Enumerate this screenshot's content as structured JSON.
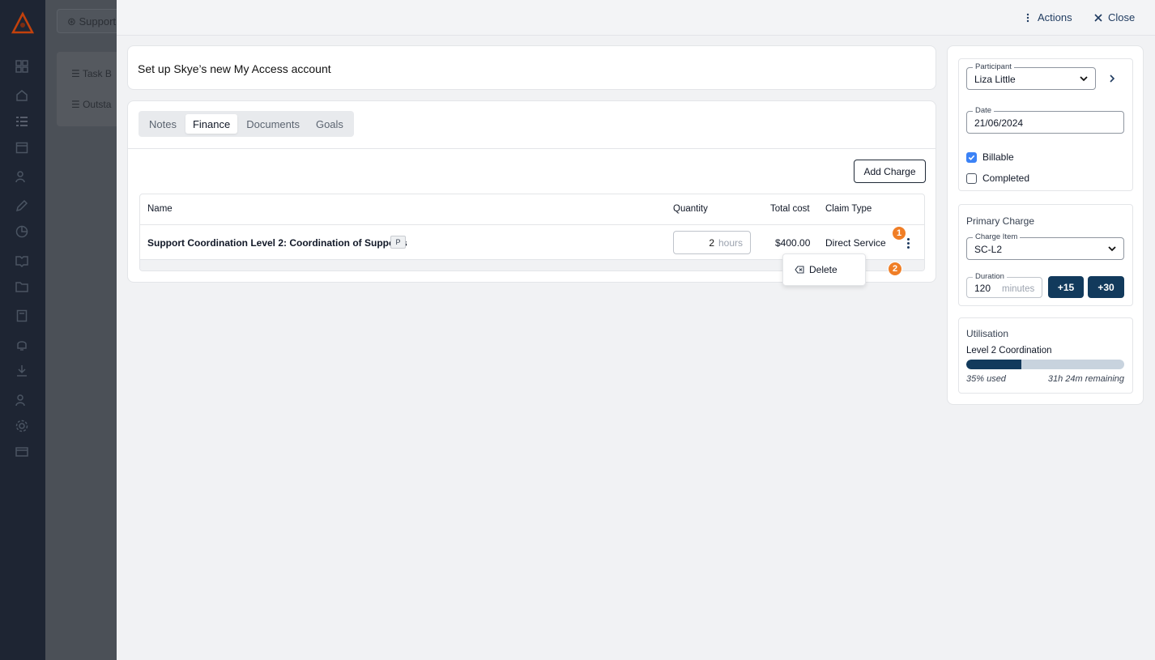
{
  "background": {
    "tab_label": "Support",
    "rows": [
      "Task B",
      "Outsta"
    ]
  },
  "header": {
    "actions_label": "Actions",
    "close_label": "Close"
  },
  "task": {
    "title": "Set up Skye’s new My Access account"
  },
  "tabs": [
    {
      "label": "Notes",
      "active": false
    },
    {
      "label": "Finance",
      "active": true
    },
    {
      "label": "Documents",
      "active": false
    },
    {
      "label": "Goals",
      "active": false
    }
  ],
  "finance": {
    "add_charge_label": "Add Charge",
    "columns": {
      "name": "Name",
      "quantity": "Quantity",
      "total_cost": "Total cost",
      "claim_type": "Claim Type"
    },
    "rows": [
      {
        "name": "Support Coordination Level 2: Coordination of Supports",
        "badge": "P",
        "quantity": "2",
        "quantity_unit": "hours",
        "total_cost": "$400.00",
        "claim_type": "Direct Service"
      }
    ]
  },
  "row_menu": {
    "delete_label": "Delete"
  },
  "markers": [
    "1",
    "2"
  ],
  "sidebar": {
    "participant": {
      "label": "Participant",
      "value": "Liza Little"
    },
    "date": {
      "label": "Date",
      "value": "21/06/2024"
    },
    "billable": {
      "label": "Billable",
      "checked": true
    },
    "completed": {
      "label": "Completed",
      "checked": false
    },
    "primary_charge": {
      "title": "Primary Charge",
      "charge_item_label": "Charge Item",
      "charge_item_value": "SC-L2",
      "duration_label": "Duration",
      "duration_value": "120",
      "duration_unit": "minutes",
      "plus15_label": "+15",
      "plus30_label": "+30"
    },
    "utilisation": {
      "title": "Utilisation",
      "item": "Level 2 Coordination",
      "used_fraction": 0.35,
      "used_text": "35% used",
      "remaining_text": "31h 24m remaining"
    }
  },
  "colors": {
    "accent_dark": "#123a5c",
    "marker": "#f07e26",
    "checkbox": "#3b82f6"
  }
}
